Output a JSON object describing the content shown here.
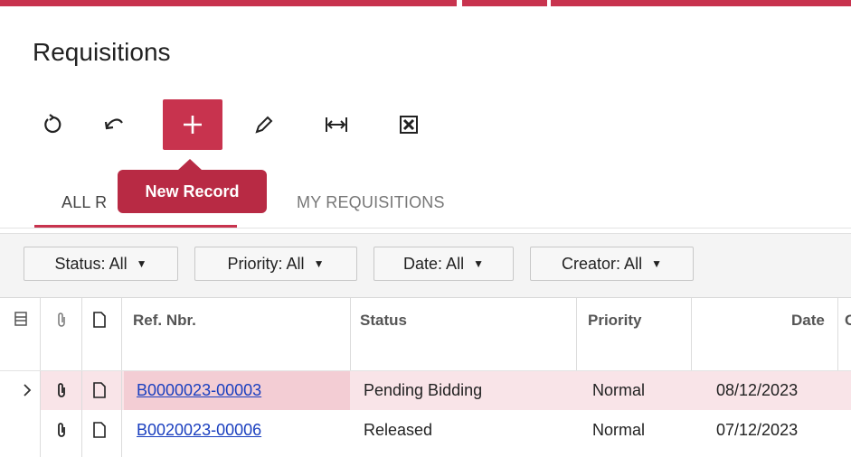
{
  "colors": {
    "accent": "#c8334e",
    "accent_dark": "#b82a44",
    "row_highlight": "#f9e4e8",
    "ref_highlight": "#f3cdd4",
    "link": "#1a3fbf"
  },
  "page": {
    "title": "Requisitions"
  },
  "toolbar": {
    "buttons": [
      {
        "name": "refresh-icon"
      },
      {
        "name": "undo-icon"
      },
      {
        "name": "plus-icon"
      },
      {
        "name": "pencil-icon"
      },
      {
        "name": "fit-columns-icon"
      },
      {
        "name": "excel-icon"
      }
    ]
  },
  "tooltip": {
    "text": "New Record"
  },
  "tabs": {
    "all": "ALL R",
    "my": "MY REQUISITIONS"
  },
  "filters": [
    {
      "label": "Status: All"
    },
    {
      "label": "Priority: All"
    },
    {
      "label": "Date: All"
    },
    {
      "label": "Creator: All"
    }
  ],
  "table": {
    "columns": {
      "ref": "Ref. Nbr.",
      "status": "Status",
      "priority": "Priority",
      "date": "Date",
      "partial": "C"
    },
    "rows": [
      {
        "ref": "B0000023-00003",
        "status": "Pending Bidding",
        "priority": "Normal",
        "date": "08/12/2023"
      },
      {
        "ref": "B0020023-00006",
        "status": "Released",
        "priority": "Normal",
        "date": "07/12/2023"
      }
    ]
  }
}
